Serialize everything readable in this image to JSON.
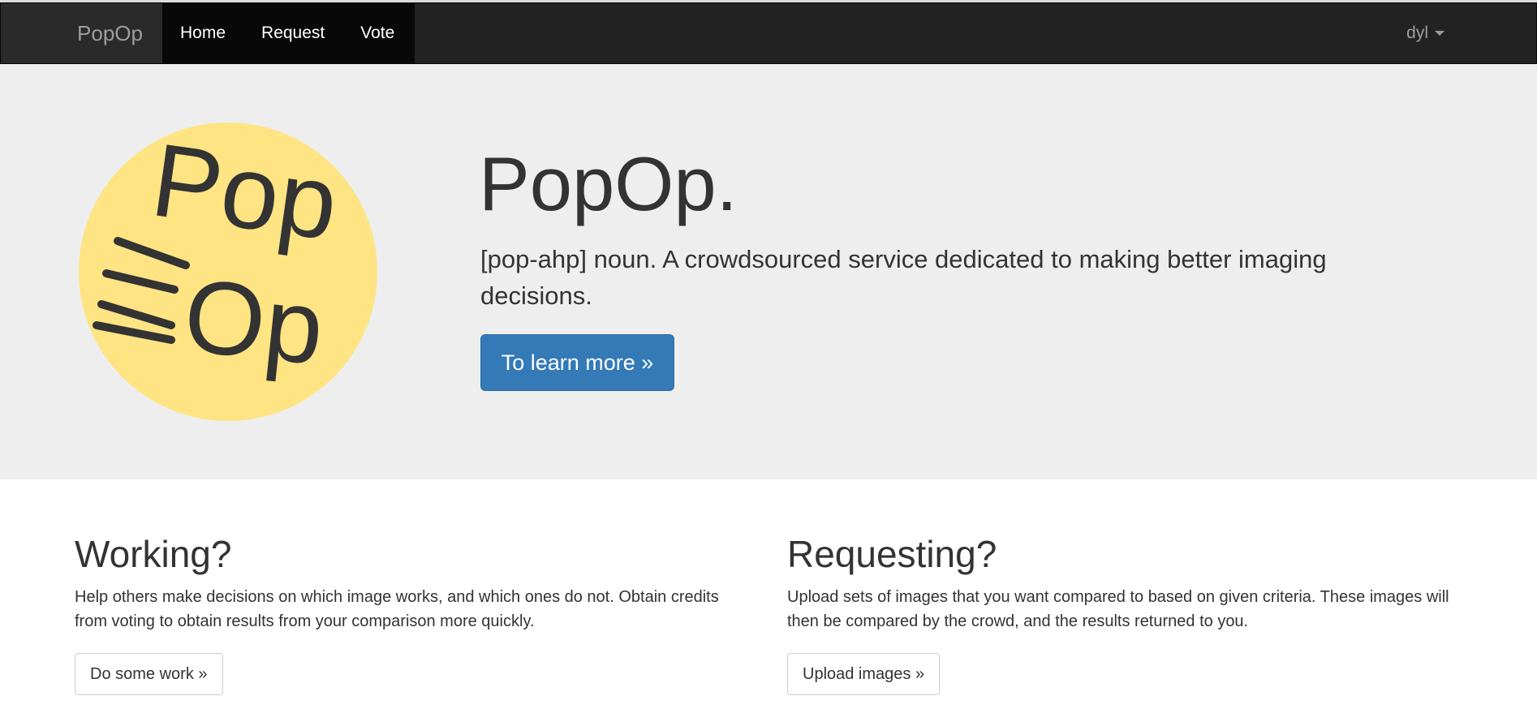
{
  "navbar": {
    "brand": "PopOp",
    "links": [
      "Home",
      "Request",
      "Vote"
    ],
    "user": "dyl"
  },
  "hero": {
    "logo_lines": [
      "Pop",
      "Op"
    ],
    "title": "PopOp.",
    "description": "[pop-ahp] noun. A crowdsourced service dedicated to making better imaging decisions.",
    "button": "To learn more »"
  },
  "columns": [
    {
      "heading": "Working?",
      "text": "Help others make decisions on which image works, and which ones do not. Obtain credits from voting to obtain results from your comparison more quickly.",
      "button": "Do some work »"
    },
    {
      "heading": "Requesting?",
      "text": "Upload sets of images that you want compared to based on given criteria. These images will then be compared by the crowd, and the results returned to you.",
      "button": "Upload images »"
    }
  ],
  "colors": {
    "navbar": "#222222",
    "hero_bg": "#eeeeee",
    "logo_yellow": "#ffe484",
    "primary": "#337ab7"
  }
}
